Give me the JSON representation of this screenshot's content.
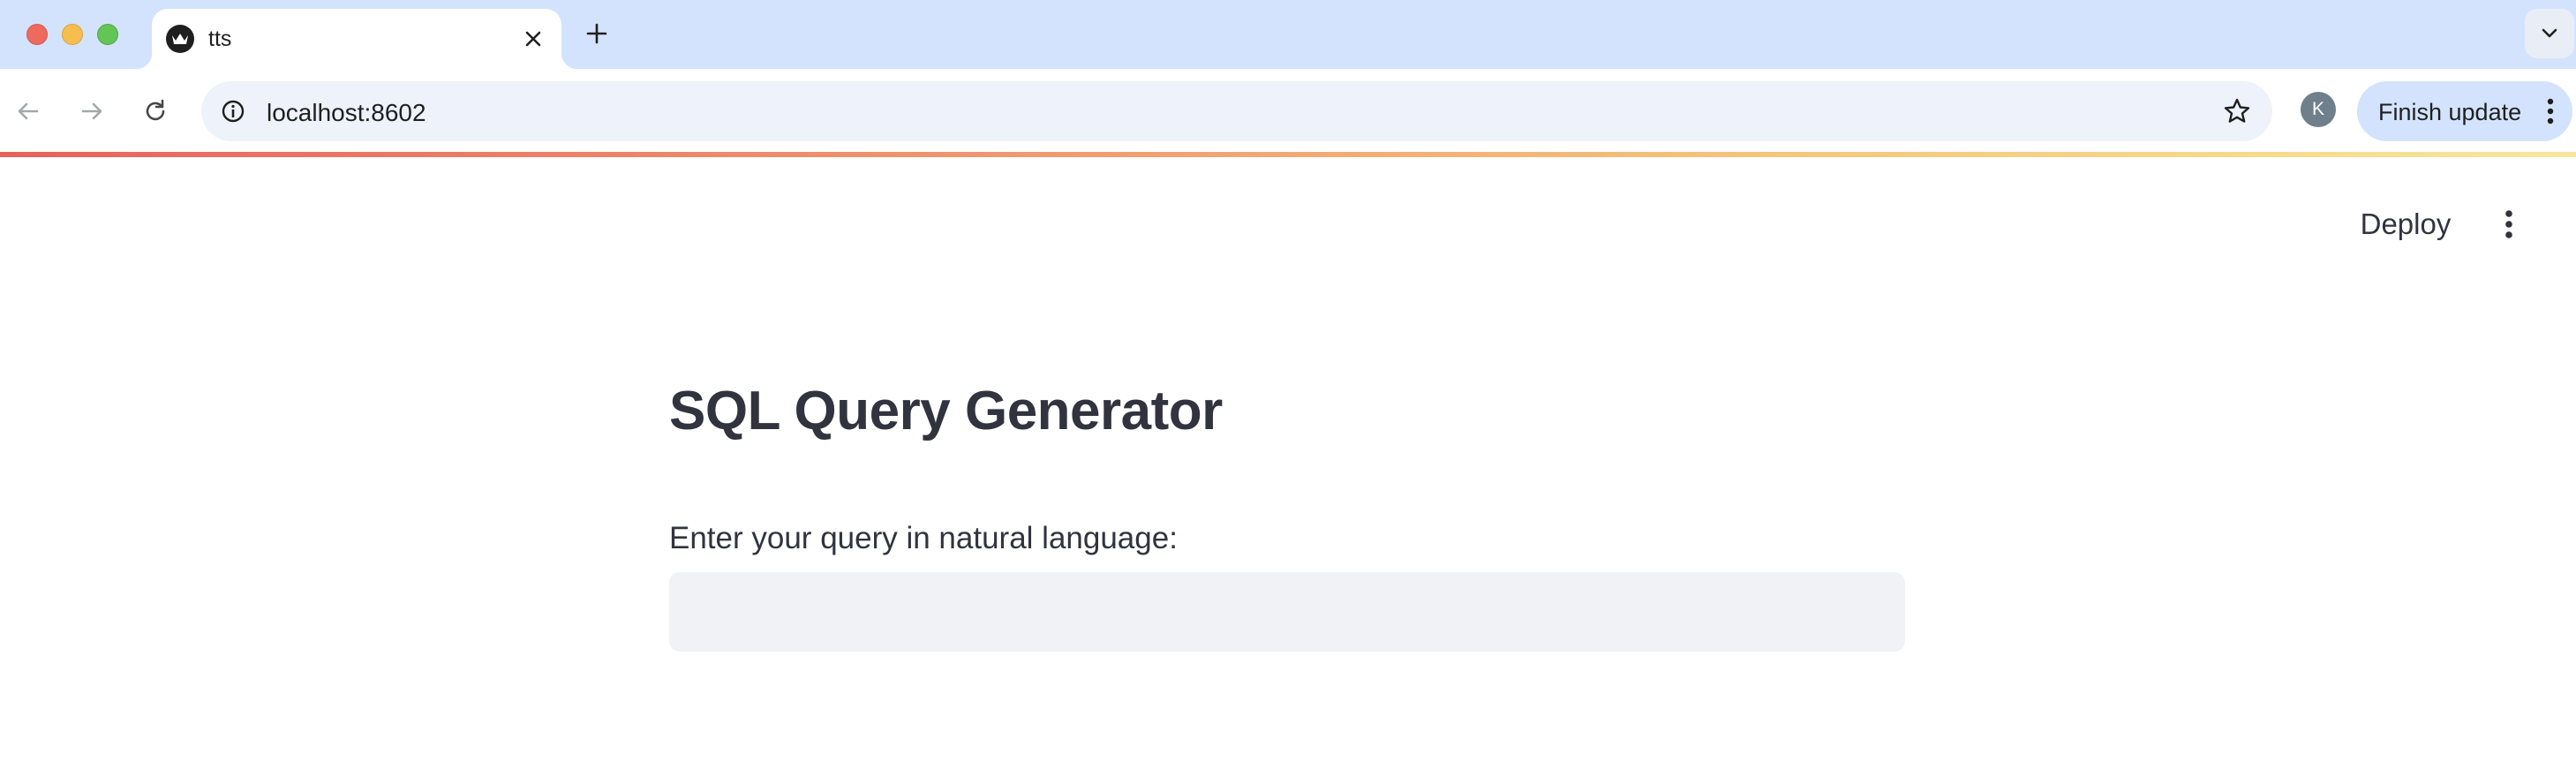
{
  "browser": {
    "tab": {
      "title": "tts",
      "favicon": "streamlit-crown-icon"
    },
    "new_tab_icon": "plus-icon",
    "tab_search_icon": "chevron-down-icon",
    "url": "localhost:8602",
    "profile_initial": "K",
    "finish_update_label": "Finish update",
    "colors": {
      "tabstrip": "#d3e3fd",
      "omnibox": "#eef2fa",
      "finish_update_bg": "#d3e3fd"
    }
  },
  "app": {
    "deploy_label": "Deploy",
    "menu_icon": "vertical-dots-icon",
    "title": "SQL Query Generator",
    "query_label": "Enter your query in natural language:",
    "query_value": "",
    "colors": {
      "text": "#31333f",
      "input_bg": "#f0f2f6"
    }
  }
}
